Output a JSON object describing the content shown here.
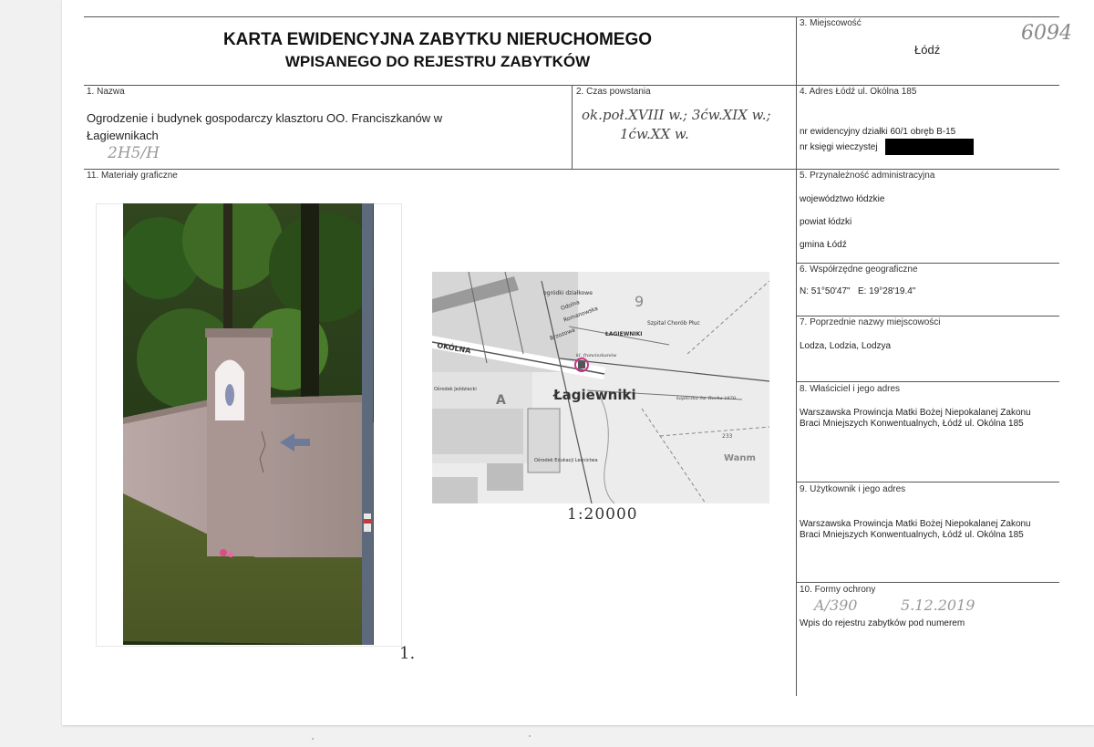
{
  "header": {
    "title_line1": "KARTA EWIDENCYJNA ZABYTKU NIERUCHOMEGO",
    "title_line2": "WPISANEGO DO REJESTRU ZABYTKÓW",
    "handwritten_number": "6094"
  },
  "locality": {
    "label": "3. Miejscowość",
    "value": "Łódź"
  },
  "name": {
    "label": "1. Nazwa",
    "value_line1": "Ogrodzenie i budynek gospodarczy klasztoru OO. Franciszkanów w",
    "value_line2": "Łagiewnikach",
    "handwritten_ref": "2H5/H"
  },
  "creation_time": {
    "label": "2. Czas powstania",
    "handwritten_line1": "ok.poł.XVIII w.; 3ćw.XIX w.;",
    "handwritten_line2": "1ćw.XX w."
  },
  "address": {
    "label": "4. Adres Łódź ul. Okólna 185",
    "parcel": "nr ewidencyjny działki 60/1 obręb B-15",
    "land_register": "nr księgi wieczystej"
  },
  "graphics": {
    "label": "11. Materiały graficzne",
    "photo_number": "1.",
    "scale": "1:20000"
  },
  "admin": {
    "label": "5. Przynależność administracyjna",
    "voivodeship": "województwo łódzkie",
    "county": "powiat łódzki",
    "commune": "gmina Łódź"
  },
  "coords": {
    "label": "6. Współrzędne geograficzne",
    "value": "N: 51°50'47\"   E: 19°28'19.4\""
  },
  "former_names": {
    "label": "7. Poprzednie nazwy miejscowości",
    "value": "Lodza, Lodzia, Lodzya"
  },
  "owner": {
    "label": "8. Właściciel i jego adres",
    "line1": "Warszawska Prowincja Matki Bożej Niepokalanej Zakonu",
    "line2": "Braci Mniejszych Konwentualnych, Łódź ul. Okólna 185"
  },
  "user": {
    "label": "9. Użytkownik i jego adres",
    "line1": "Warszawska Prowincja Matki Bożej Niepokalanej Zakonu",
    "line2": "Braci Mniejszych Konwentualnych, Łódź ul. Okólna 185"
  },
  "protection": {
    "label": "10. Formy ochrony",
    "handwritten_reg": "A/390",
    "handwritten_date": "5.12.2019",
    "value": "Wpis do rejestru zabytków pod numerem"
  },
  "map": {
    "labels": {
      "okolna": "OKÓLNA",
      "lagiewniki": "Łagiewniki",
      "lagiewniki_small": "ŁAGIEWNIKI",
      "ogrodki": "ogródki działkowe",
      "szpital": "Szpital Chorób Płuc",
      "brzozowa": "Brzozowa",
      "romanowska": "Romanowska",
      "odolna": "Odolna",
      "osrodek": "Ośrodek Edukacji Leśnictwa",
      "jezdzieckl": "Ośrodek Jeździecki",
      "kapliczka": "kapliczka św. Rocha 1870",
      "franciszkanow": "kl. franciszkanów",
      "wanm": "Wanm",
      "zone_a": "A",
      "num9": "9",
      "num233": "233"
    }
  },
  "colors": {
    "ink": "#222222",
    "rule": "#555555",
    "map_road": "#555555",
    "redaction": "#000000"
  }
}
